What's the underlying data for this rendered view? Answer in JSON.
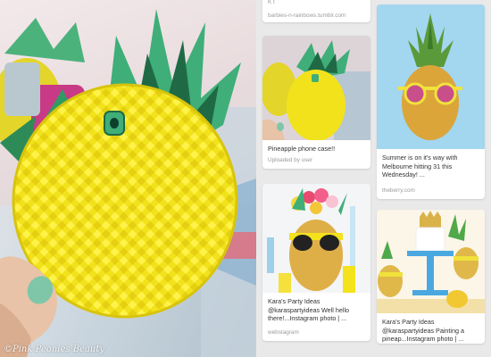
{
  "hero": {
    "description": "Pineapple phone case held in hand",
    "watermark": "©Pink Peonies Beauty"
  },
  "feed": {
    "column1": [
      {
        "partial_top_text": "K t",
        "source": "barbies-n-rainbows.tumblr.com",
        "type": "source-only"
      },
      {
        "description": "Pineapple phone case!!",
        "meta": "Uploaded by user"
      },
      {
        "description": "Kara's Party Ideas @karaspartyideas Well hello there!...Instagram photo | ...",
        "meta": "webstagram"
      }
    ],
    "column2": [
      {
        "description": "Summer is on it's way with Melbourne hitting 31 this Wednesday! ...",
        "meta": "theberry.com"
      },
      {
        "description": "Kara's Party Ideas @karaspartyideas Painting a pineap...Instagram photo | ...",
        "meta": ""
      }
    ]
  },
  "colors": {
    "pineapple_yellow": "#f2e21c",
    "leaf_green": "#3fae79",
    "leaf_dark": "#1f6a45",
    "sky_blue": "#9fd4ee",
    "feed_bg": "#e9e9e9"
  }
}
